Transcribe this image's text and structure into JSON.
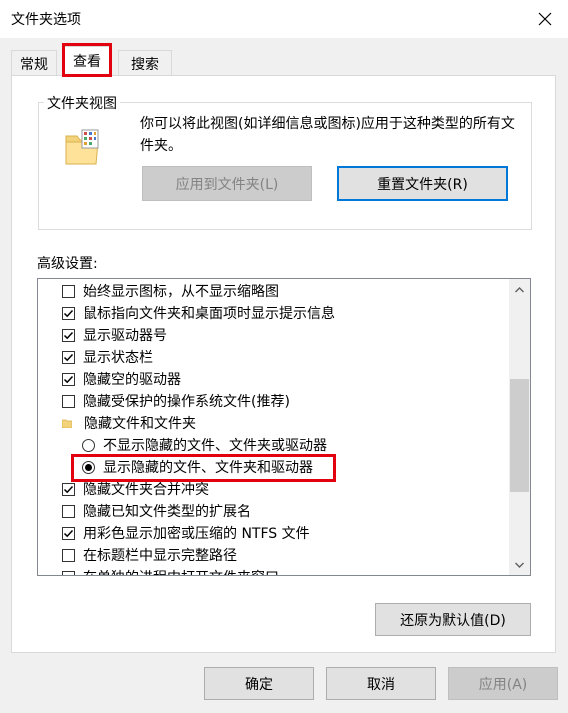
{
  "window": {
    "title": "文件夹选项",
    "close_icon": "close-icon"
  },
  "tabs": [
    {
      "label": "常规"
    },
    {
      "label": "查看",
      "active": true
    },
    {
      "label": "搜索"
    }
  ],
  "folder_views": {
    "legend": "文件夹视图",
    "description": "你可以将此视图(如详细信息或图标)应用于这种类型的所有文件夹。",
    "apply_button": "应用到文件夹(L)",
    "reset_button": "重置文件夹(R)"
  },
  "advanced": {
    "label": "高级设置:",
    "items": [
      {
        "type": "checkbox",
        "label": "始终显示图标，从不显示缩略图",
        "checked": false
      },
      {
        "type": "checkbox",
        "label": "鼠标指向文件夹和桌面项时显示提示信息",
        "checked": true
      },
      {
        "type": "checkbox",
        "label": "显示驱动器号",
        "checked": true
      },
      {
        "type": "checkbox",
        "label": "显示状态栏",
        "checked": true
      },
      {
        "type": "checkbox",
        "label": "隐藏空的驱动器",
        "checked": true
      },
      {
        "type": "checkbox",
        "label": "隐藏受保护的操作系统文件(推荐)",
        "checked": false
      },
      {
        "type": "folder",
        "label": "隐藏文件和文件夹"
      },
      {
        "type": "radio",
        "label": "不显示隐藏的文件、文件夹或驱动器",
        "checked": false
      },
      {
        "type": "radio",
        "label": "显示隐藏的文件、文件夹和驱动器",
        "checked": true
      },
      {
        "type": "checkbox",
        "label": "隐藏文件夹合并冲突",
        "checked": true
      },
      {
        "type": "checkbox",
        "label": "隐藏已知文件类型的扩展名",
        "checked": false
      },
      {
        "type": "checkbox",
        "label": "用彩色显示加密或压缩的 NTFS 文件",
        "checked": true
      },
      {
        "type": "checkbox",
        "label": "在标题栏中显示完整路径",
        "checked": false
      },
      {
        "type": "checkbox",
        "label": "在单独的进程中打开文件夹窗口",
        "checked": false
      }
    ],
    "restore_button": "还原为默认值(D)"
  },
  "footer": {
    "ok": "确定",
    "cancel": "取消",
    "apply": "应用(A)"
  },
  "colors": {
    "highlight": "#e3000f",
    "focus": "#0078d7"
  }
}
